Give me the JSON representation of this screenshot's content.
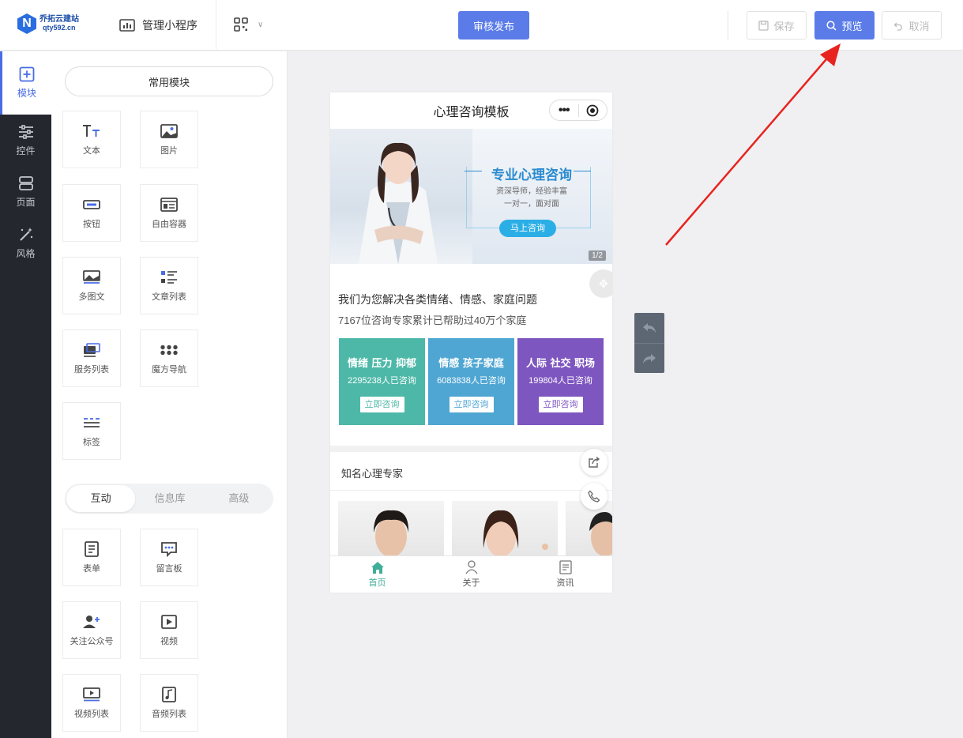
{
  "brand": {
    "name": "乔拓云建站",
    "url": "qty592.cn",
    "mark": "N"
  },
  "header": {
    "manage_label": "管理小程序",
    "publish_label": "审核发布",
    "save_label": "保存",
    "preview_label": "预览",
    "cancel_label": "取消"
  },
  "leftnav": [
    {
      "label": "模块",
      "icon": "plus-square-icon",
      "active": true
    },
    {
      "label": "控件",
      "icon": "sliders-icon"
    },
    {
      "label": "页面",
      "icon": "page-icon"
    },
    {
      "label": "风格",
      "icon": "magic-wand-icon"
    }
  ],
  "panel": {
    "common_title": "常用模块",
    "common_modules": [
      {
        "label": "文本",
        "icon": "text-icon"
      },
      {
        "label": "图片",
        "icon": "image-icon"
      },
      {
        "label": "按钮",
        "icon": "button-icon"
      },
      {
        "label": "自由容器",
        "icon": "container-icon"
      },
      {
        "label": "多图文",
        "icon": "multi-image-icon"
      },
      {
        "label": "文章列表",
        "icon": "article-list-icon"
      },
      {
        "label": "服务列表",
        "icon": "service-list-icon"
      },
      {
        "label": "魔方导航",
        "icon": "grid-nav-icon"
      },
      {
        "label": "标签",
        "icon": "tag-icon"
      }
    ],
    "tabs": [
      "互动",
      "信息库",
      "高级"
    ],
    "interactive_modules": [
      {
        "label": "表单",
        "icon": "form-icon"
      },
      {
        "label": "留言板",
        "icon": "message-board-icon"
      },
      {
        "label": "关注公众号",
        "icon": "follow-account-icon"
      },
      {
        "label": "视频",
        "icon": "video-icon"
      },
      {
        "label": "视频列表",
        "icon": "video-list-icon"
      },
      {
        "label": "音频列表",
        "icon": "audio-list-icon"
      }
    ]
  },
  "phone": {
    "title": "心理咨询模板",
    "capsule_dots": "•••",
    "banner": {
      "headline": "专业心理咨询",
      "sub1": "资深导师，经验丰富",
      "sub2": "一对一，面对面",
      "button": "马上咨询",
      "pager": "1/2"
    },
    "intro1": "我们为您解决各类情绪、情感、家庭问题",
    "intro2": "7167位咨询专家累计已帮助过40万个家庭",
    "cards": [
      {
        "title": "情绪 压力 抑郁",
        "count": "2295238人已咨询",
        "button": "立即咨询",
        "color": "#4db8a8"
      },
      {
        "title": "情感 孩子家庭",
        "count": "6083838人已咨询",
        "button": "立即咨询",
        "color": "#4fa6d3"
      },
      {
        "title": "人际 社交 职场",
        "count": "199804人已咨询",
        "button": "立即咨询",
        "color": "#7e56c0"
      }
    ],
    "experts_title": "知名心理专家",
    "tabbar": [
      {
        "label": "首页",
        "icon": "home-icon",
        "active": true
      },
      {
        "label": "关于",
        "icon": "user-icon"
      },
      {
        "label": "资讯",
        "icon": "news-icon"
      }
    ]
  },
  "colors": {
    "accent": "#5b7ce8",
    "nav_bg": "#24272e",
    "arrow": "#e8231f"
  }
}
